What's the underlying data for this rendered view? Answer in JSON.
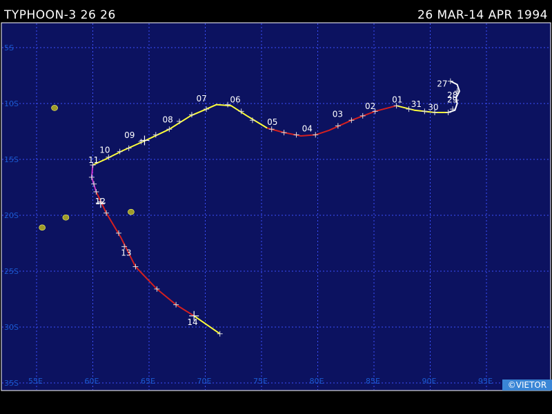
{
  "header": {
    "title": "TYPHOON-3 26 26",
    "dates": "26 MAR-14 APR 1994"
  },
  "map": {
    "ocean_color": "#0c1260",
    "grid_color": "#3c50ff",
    "land_color": "#9e9b2a",
    "lon_ticks": [
      "55E",
      "60E",
      "65E",
      "70E",
      "75E",
      "80E",
      "85E",
      "90E",
      "95E"
    ],
    "lat_ticks": [
      "5S",
      "10S",
      "15S",
      "20S",
      "25S",
      "30S",
      "35S"
    ],
    "lon_values": [
      55,
      60,
      65,
      70,
      75,
      80,
      85,
      90,
      95
    ],
    "lat_values": [
      -5,
      -10,
      -15,
      -20,
      -25,
      -30,
      -35
    ]
  },
  "track": {
    "segments": [
      {
        "color": "#ffffff",
        "points": [
          [
            91.8,
            -8
          ],
          [
            92.4,
            -8.3
          ],
          [
            92.6,
            -8.9
          ],
          [
            92.3,
            -9.5
          ],
          [
            92.4,
            -10
          ],
          [
            92.2,
            -10.6
          ],
          [
            91.6,
            -10.8
          ]
        ]
      },
      {
        "color": "#ffff3a",
        "points": [
          [
            91.6,
            -10.8
          ],
          [
            90.4,
            -10.8
          ],
          [
            88.6,
            -10.6
          ],
          [
            87,
            -10.2
          ]
        ]
      },
      {
        "color": "#d42020",
        "points": [
          [
            87,
            -10.2
          ],
          [
            85.1,
            -10.7
          ],
          [
            83,
            -11.5
          ],
          [
            81,
            -12.4
          ],
          [
            79.8,
            -12.8
          ],
          [
            78.5,
            -12.9
          ],
          [
            77,
            -12.6
          ],
          [
            75.5,
            -12.2
          ]
        ]
      },
      {
        "color": "#ffff3a",
        "points": [
          [
            75.5,
            -12.2
          ],
          [
            73.7,
            -11.1
          ],
          [
            72.3,
            -10.2
          ],
          [
            71,
            -10.1
          ],
          [
            70.1,
            -10.5
          ],
          [
            68.7,
            -11.1
          ],
          [
            66.8,
            -12.3
          ],
          [
            64.7,
            -13.3
          ],
          [
            62.7,
            -14.2
          ],
          [
            61.1,
            -15
          ],
          [
            60,
            -15.5
          ]
        ]
      },
      {
        "color": "#cc33cc",
        "points": [
          [
            60,
            -15.5
          ],
          [
            59.9,
            -16.6
          ],
          [
            60.3,
            -17.9
          ]
        ]
      },
      {
        "color": "#d42020",
        "points": [
          [
            60.3,
            -17.9
          ],
          [
            61.2,
            -19.8
          ],
          [
            62.5,
            -22
          ],
          [
            63.8,
            -24.6
          ],
          [
            65.7,
            -26.6
          ],
          [
            67.4,
            -28
          ],
          [
            69,
            -29
          ]
        ]
      },
      {
        "color": "#ffff3a",
        "points": [
          [
            69,
            -29
          ],
          [
            71.3,
            -30.6
          ]
        ]
      }
    ],
    "tick_points": [
      [
        91.6,
        -10.8
      ],
      [
        90.4,
        -10.8
      ],
      [
        89.5,
        -10.7
      ],
      [
        88.1,
        -10.5
      ],
      [
        87,
        -10.2
      ],
      [
        85.1,
        -10.7
      ],
      [
        84,
        -11.1
      ],
      [
        83,
        -11.5
      ],
      [
        81.8,
        -12
      ],
      [
        79.8,
        -12.8
      ],
      [
        78.1,
        -12.8
      ],
      [
        77,
        -12.6
      ],
      [
        75.9,
        -12.3
      ],
      [
        74.2,
        -11.5
      ],
      [
        73.2,
        -10.7
      ],
      [
        72,
        -10.1
      ],
      [
        70.1,
        -10.5
      ],
      [
        68.8,
        -11
      ],
      [
        67.7,
        -11.6
      ],
      [
        66.8,
        -12.3
      ],
      [
        65.6,
        -12.8
      ],
      [
        64.3,
        -13.4
      ],
      [
        63.2,
        -14
      ],
      [
        62.4,
        -14.3
      ],
      [
        61.4,
        -14.8
      ],
      [
        60,
        -15.5
      ],
      [
        59.9,
        -16.6
      ],
      [
        60.1,
        -17.2
      ],
      [
        60.3,
        -17.9
      ],
      [
        60.7,
        -18.8
      ],
      [
        61.2,
        -19.8
      ],
      [
        62.3,
        -21.6
      ],
      [
        62.8,
        -22.8
      ],
      [
        63.8,
        -24.6
      ],
      [
        65.7,
        -26.6
      ],
      [
        67.4,
        -28
      ],
      [
        71.3,
        -30.6
      ],
      [
        91.8,
        -8
      ],
      [
        92.4,
        -8.9
      ],
      [
        92.3,
        -9.7
      ],
      [
        92,
        -10.5
      ]
    ],
    "big_ticks": [
      [
        60.7,
        -18.9
      ],
      [
        69,
        -29
      ],
      [
        64.6,
        -13.3
      ]
    ],
    "day_labels": [
      {
        "text": "27",
        "lon": 90.6,
        "lat": -8.5
      },
      {
        "text": "28",
        "lon": 91.5,
        "lat": -9.5
      },
      {
        "text": "29",
        "lon": 91.5,
        "lat": -9.9
      },
      {
        "text": "30",
        "lon": 89.8,
        "lat": -10.6
      },
      {
        "text": "31",
        "lon": 88.3,
        "lat": -10.3
      },
      {
        "text": "01",
        "lon": 86.6,
        "lat": -9.9
      },
      {
        "text": "02",
        "lon": 84.2,
        "lat": -10.5
      },
      {
        "text": "03",
        "lon": 81.3,
        "lat": -11.2
      },
      {
        "text": "04",
        "lon": 78.6,
        "lat": -12.5
      },
      {
        "text": "05",
        "lon": 75.5,
        "lat": -11.9
      },
      {
        "text": "06",
        "lon": 72.2,
        "lat": -9.9
      },
      {
        "text": "07",
        "lon": 69.2,
        "lat": -9.8
      },
      {
        "text": "08",
        "lon": 66.2,
        "lat": -11.7
      },
      {
        "text": "09",
        "lon": 62.8,
        "lat": -13.1
      },
      {
        "text": "10",
        "lon": 60.6,
        "lat": -14.4
      },
      {
        "text": "11",
        "lon": 59.6,
        "lat": -15.3
      },
      {
        "text": "12",
        "lon": 60.2,
        "lat": -19
      },
      {
        "text": "13",
        "lon": 62.5,
        "lat": -23.6
      },
      {
        "text": "14",
        "lon": 68.4,
        "lat": -29.8
      }
    ]
  },
  "islands": [
    {
      "name": "mauritius-island",
      "lon": 57.6,
      "lat": -20.2
    },
    {
      "name": "reunion-island",
      "lon": 55.5,
      "lat": -21.1
    },
    {
      "name": "agalega-island",
      "lon": 56.6,
      "lat": -10.4
    },
    {
      "name": "rodrigues-island",
      "lon": 63.4,
      "lat": -19.7
    }
  ],
  "footer": {
    "credit": "©VIETOR"
  }
}
